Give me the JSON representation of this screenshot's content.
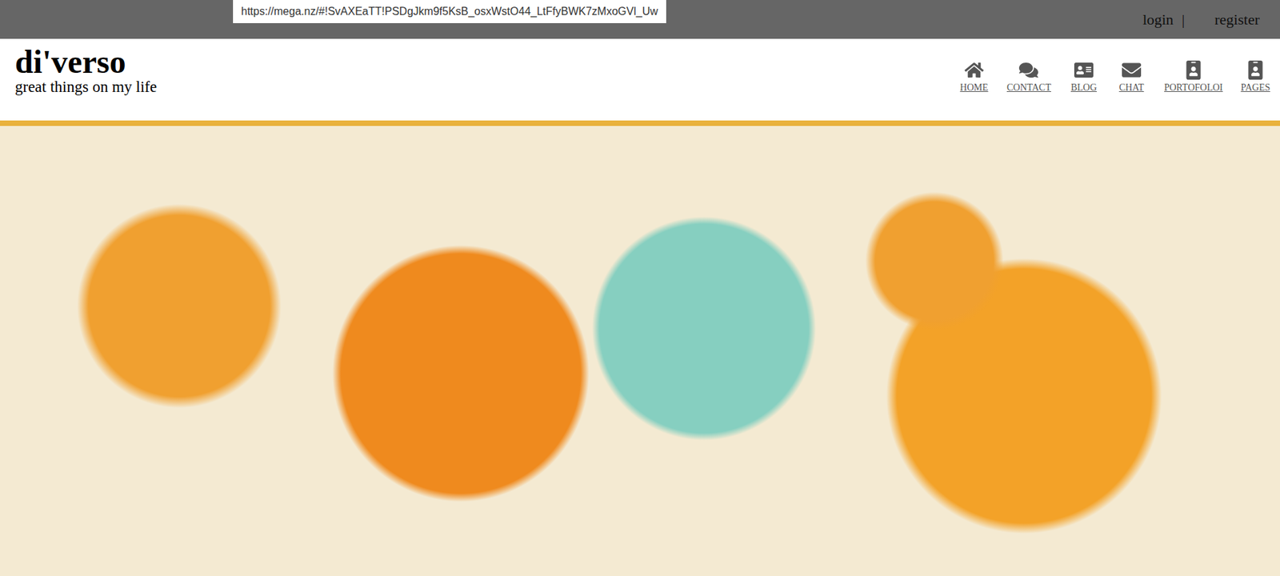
{
  "top_bar": {
    "url": "https://mega.nz/#!SvAXEaTT!PSDgJkm9f5KsB_osxWstO44_LtFfyBWK7zMxoGVl_Uw",
    "login": "login",
    "separator": "|",
    "register": "register"
  },
  "header": {
    "title": "di'verso",
    "tagline": "great things on my life"
  },
  "nav": [
    {
      "label": "HOME"
    },
    {
      "label": "CONTACT"
    },
    {
      "label": "BLOG"
    },
    {
      "label": "CHAT"
    },
    {
      "label": "PORTOFOLOI"
    },
    {
      "label": "PAGES"
    }
  ],
  "banner": {
    "kind": "photo"
  }
}
